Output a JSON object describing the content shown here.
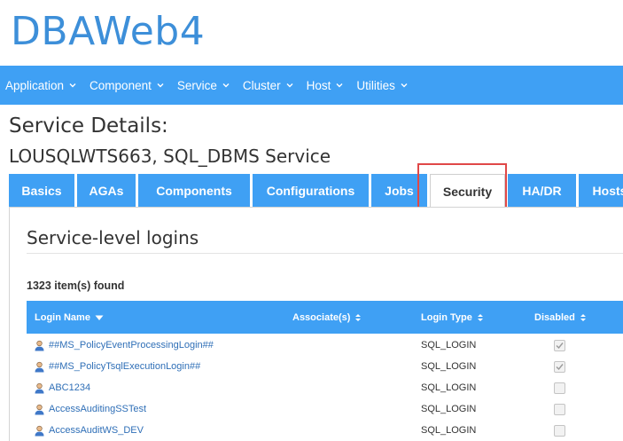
{
  "app": {
    "title": "DBAWeb4"
  },
  "nav": {
    "items": [
      {
        "label": "Application"
      },
      {
        "label": "Component"
      },
      {
        "label": "Service"
      },
      {
        "label": "Cluster"
      },
      {
        "label": "Host"
      },
      {
        "label": "Utilities"
      }
    ]
  },
  "page": {
    "title": "Service Details:",
    "subtitle": "LOUSQLWTS663, SQL_DBMS Service"
  },
  "tabs": [
    {
      "label": "Basics"
    },
    {
      "label": "AGAs"
    },
    {
      "label": "Components"
    },
    {
      "label": "Configurations"
    },
    {
      "label": "Jobs"
    },
    {
      "label": "Security",
      "active": true
    },
    {
      "label": "HA/DR"
    },
    {
      "label": "Hosts"
    }
  ],
  "section": {
    "title": "Service-level logins",
    "count": "1323 item(s) found"
  },
  "table": {
    "columns": [
      {
        "label": "Login Name",
        "sort": "desc"
      },
      {
        "label": "Associate(s)",
        "sort": "both"
      },
      {
        "label": "Login Type",
        "sort": "both"
      },
      {
        "label": "Disabled",
        "sort": "both"
      }
    ],
    "rows": [
      {
        "login": "##MS_PolicyEventProcessingLogin##",
        "type": "SQL_LOGIN",
        "disabled": true
      },
      {
        "login": "##MS_PolicyTsqlExecutionLogin##",
        "type": "SQL_LOGIN",
        "disabled": true
      },
      {
        "login": "ABC1234",
        "type": "SQL_LOGIN",
        "disabled": false
      },
      {
        "login": "AccessAuditingSSTest",
        "type": "SQL_LOGIN",
        "disabled": false
      },
      {
        "login": "AccessAuditWS_DEV",
        "type": "SQL_LOGIN",
        "disabled": false
      }
    ]
  },
  "colors": {
    "accent": "#3fa0f4",
    "title": "#3d8fd9",
    "link": "#2f6fb7",
    "highlight": "#e04848"
  }
}
